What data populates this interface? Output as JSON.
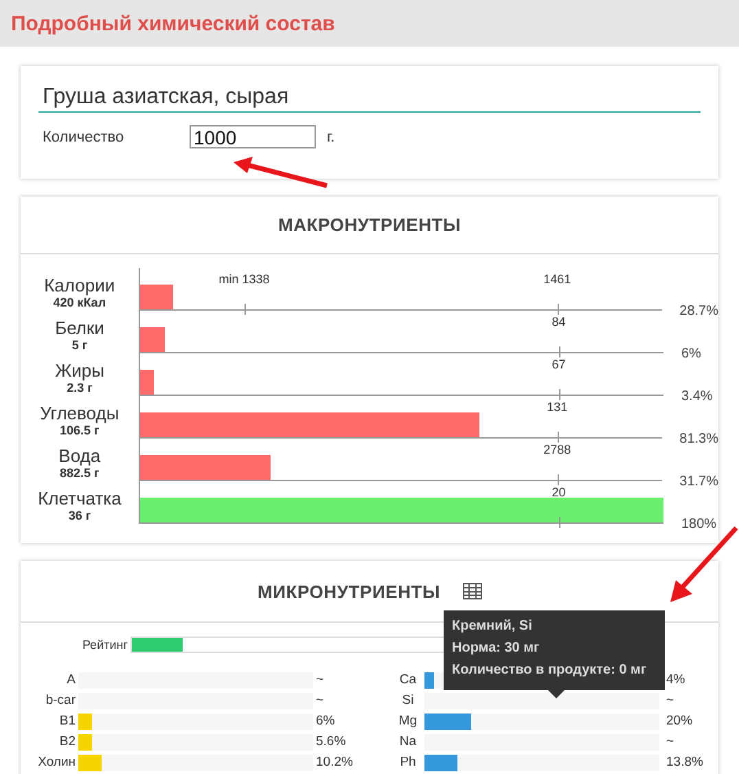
{
  "dialog": {
    "title": "Подробный химический состав"
  },
  "product": {
    "name": "Груша азиатская, сырая",
    "quantity_label": "Количество",
    "quantity": "1000",
    "unit": "г."
  },
  "macronutrients": {
    "title": "МАКРОНУТРИЕНТЫ",
    "rows": [
      {
        "name": "Калории",
        "amount": "420 кКал",
        "level": 0.063,
        "min": "min 1338",
        "norm": "1461",
        "percent": "28.7%",
        "color": "#ff6b6b"
      },
      {
        "name": "Белки",
        "amount": "5 г",
        "level": 0.047,
        "norm": "84",
        "percent": "6%",
        "color": "#ff6b6b"
      },
      {
        "name": "Жиры",
        "amount": "2.3 г",
        "level": 0.027,
        "norm": "67",
        "percent": "3.4%",
        "color": "#ff6b6b"
      },
      {
        "name": "Углеводы",
        "amount": "106.5 г",
        "level": 0.65,
        "norm": "131",
        "percent": "81.3%",
        "color": "#ff6b6b"
      },
      {
        "name": "Вода",
        "amount": "882.5 г",
        "level": 0.252,
        "norm": "2788",
        "percent": "31.7%",
        "color": "#ff6b6b"
      },
      {
        "name": "Клетчатка",
        "amount": "36 г",
        "level": 1,
        "norm": "20",
        "percent": "180%",
        "color": "#6af06e"
      }
    ]
  },
  "micronutrients": {
    "title": "МИКРОНУТРИЕНТЫ",
    "rating": {
      "label": "Рейтинг",
      "level": 0.157
    },
    "columns": [
      {
        "color": "#f5d400",
        "items": [
          {
            "name": "A",
            "percent": "~"
          },
          {
            "name": "b-car",
            "percent": "~"
          },
          {
            "name": "B1",
            "level": 0.06,
            "percent": "6%"
          },
          {
            "name": "B2",
            "level": 0.056,
            "percent": "5.6%"
          },
          {
            "name": "Холин",
            "level": 0.102,
            "percent": "10.2%"
          }
        ]
      },
      {
        "color": "#3498db",
        "items": [
          {
            "name": "Ca",
            "level": 0.04,
            "percent": "4%"
          },
          {
            "name": "Si",
            "percent": "~"
          },
          {
            "name": "Mg",
            "level": 0.2,
            "percent": "20%"
          },
          {
            "name": "Na",
            "percent": "~"
          },
          {
            "name": "Ph",
            "level": 0.138,
            "percent": "13.8%"
          }
        ]
      }
    ],
    "tooltip": [
      "Кремний, Si",
      "Норма: 30 мг",
      "Количество в продукте: 0 мг"
    ]
  }
}
